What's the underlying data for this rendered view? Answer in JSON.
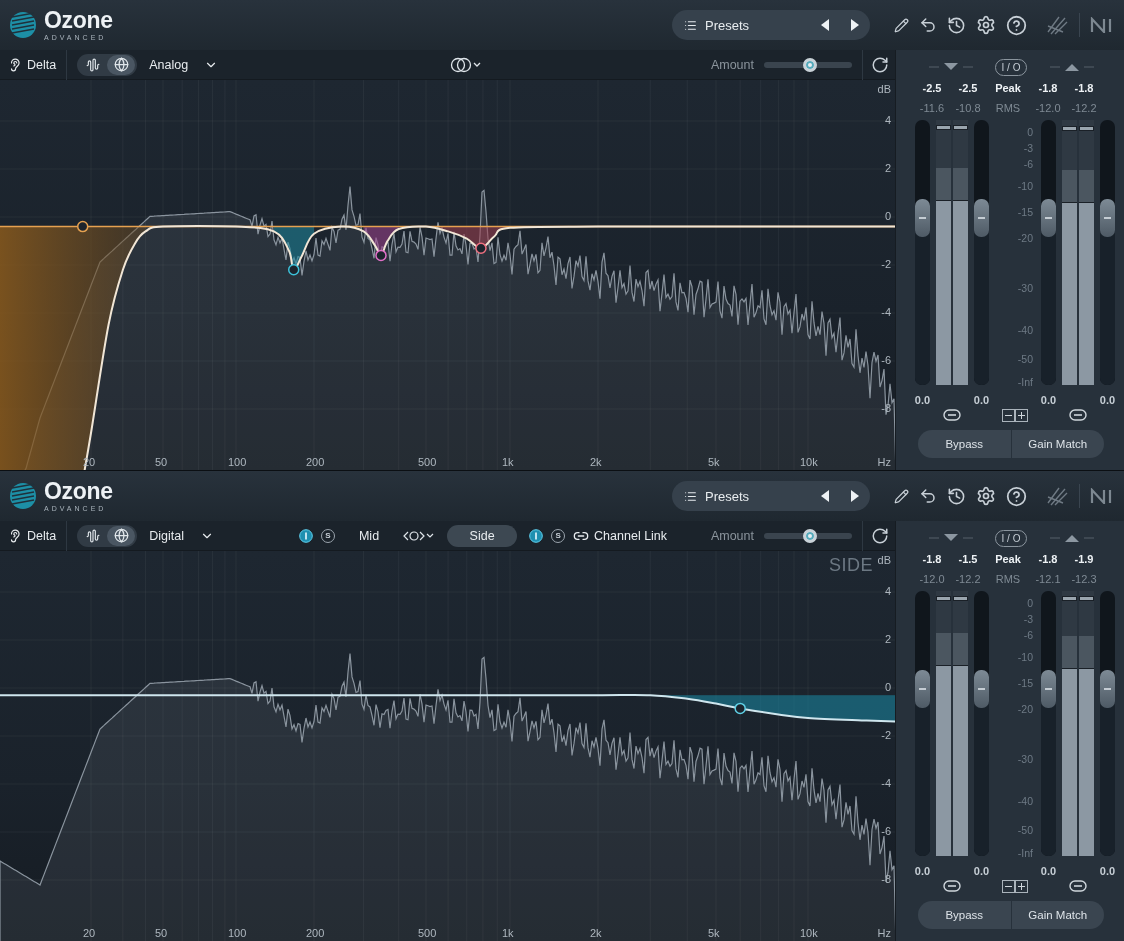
{
  "panels": [
    {
      "logo": {
        "name": "Ozone",
        "edition": "ADVANCED"
      },
      "presets": "Presets",
      "toolbar": {
        "delta": "Delta",
        "views": [
          {
            "kind": "waveform",
            "selected": false
          },
          {
            "kind": "globe",
            "selected": true
          }
        ],
        "mode": "Analog",
        "amount": {
          "label": "Amount",
          "level": 0.52
        }
      },
      "graph": {
        "y_unit": "dB",
        "y_ticks": [
          "4",
          "2",
          "0",
          "-2",
          "-4",
          "-6",
          "-8"
        ],
        "x_ticks": [
          "20",
          "50",
          "100",
          "200",
          "500",
          "1k",
          "2k",
          "5k",
          "10k"
        ],
        "x_unit": "Hz"
      },
      "meters": {
        "io": "I / O",
        "peak_label": "Peak",
        "rms_label": "RMS",
        "scale": [
          "0",
          "-3",
          "-6",
          "-10",
          "-15",
          "-20",
          "-30",
          "-40",
          "-50",
          "-Inf"
        ],
        "input": {
          "peak": [
            "-2.5",
            "-2.5"
          ],
          "rms": [
            "-11.6",
            "-10.8"
          ],
          "bars": [
            {
              "level": 0.7
            },
            {
              "level": 0.7
            }
          ],
          "faders": [
            {
              "level": 0.63,
              "reading": "0.0"
            },
            {
              "level": 0.63,
              "reading": "0.0"
            }
          ]
        },
        "output": {
          "peak": [
            "-1.8",
            "-1.8"
          ],
          "rms": [
            "-12.0",
            "-12.2"
          ],
          "bars": [
            {
              "level": 0.69
            },
            {
              "level": 0.69
            }
          ],
          "faders": [
            {
              "level": 0.63,
              "reading": "0.0"
            },
            {
              "level": 0.63,
              "reading": "0.0"
            }
          ]
        },
        "buttons": [
          "Bypass",
          "Gain Match"
        ]
      }
    },
    {
      "logo": {
        "name": "Ozone",
        "edition": "ADVANCED"
      },
      "presets": "Presets",
      "toolbar": {
        "delta": "Delta",
        "views": [
          {
            "kind": "waveform",
            "selected": false
          },
          {
            "kind": "globe",
            "selected": true
          }
        ],
        "mode": "Digital",
        "stereo": {
          "channels": [
            {
              "label": "Mid",
              "selected": false,
              "solo": "S"
            },
            {
              "label": "Side",
              "selected": true,
              "solo": "S"
            }
          ],
          "link": "Channel Link"
        },
        "amount": {
          "label": "Amount",
          "level": 0.52
        }
      },
      "graph": {
        "overlay_label": "SIDE",
        "y_unit": "dB",
        "y_ticks": [
          "4",
          "2",
          "0",
          "-2",
          "-4",
          "-6",
          "-8"
        ],
        "x_ticks": [
          "20",
          "50",
          "100",
          "200",
          "500",
          "1k",
          "2k",
          "5k",
          "10k"
        ],
        "x_unit": "Hz"
      },
      "meters": {
        "io": "I / O",
        "peak_label": "Peak",
        "rms_label": "RMS",
        "scale": [
          "0",
          "-3",
          "-6",
          "-10",
          "-15",
          "-20",
          "-30",
          "-40",
          "-50",
          "-Inf"
        ],
        "input": {
          "peak": [
            "-1.8",
            "-1.5"
          ],
          "rms": [
            "-12.0",
            "-12.2"
          ],
          "bars": [
            {
              "level": 0.72
            },
            {
              "level": 0.72
            }
          ],
          "faders": [
            {
              "level": 0.63,
              "reading": "0.0"
            },
            {
              "level": 0.63,
              "reading": "0.0"
            }
          ]
        },
        "output": {
          "peak": [
            "-1.8",
            "-1.9"
          ],
          "rms": [
            "-12.1",
            "-12.3"
          ],
          "bars": [
            {
              "level": 0.71
            },
            {
              "level": 0.71
            }
          ],
          "faders": [
            {
              "level": 0.63,
              "reading": "0.0"
            },
            {
              "level": 0.63,
              "reading": "0.0"
            }
          ]
        },
        "buttons": [
          "Bypass",
          "Gain Match"
        ]
      }
    }
  ]
}
